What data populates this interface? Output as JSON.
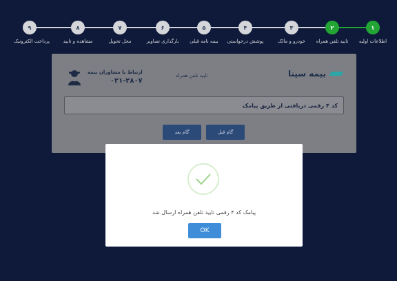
{
  "stepper": {
    "steps": [
      {
        "number": "۱",
        "label": "اطلاعات اولیه",
        "status": "done"
      },
      {
        "number": "۲",
        "label": "تایید تلفن همراه",
        "status": "done"
      },
      {
        "number": "۳",
        "label": "خودرو و مالک",
        "status": "pending"
      },
      {
        "number": "۴",
        "label": "پوشش درخواستی",
        "status": "pending"
      },
      {
        "number": "۵",
        "label": "بیمه نامه قبلی",
        "status": "pending"
      },
      {
        "number": "۶",
        "label": "بارگذاری تصاویر",
        "status": "pending"
      },
      {
        "number": "۷",
        "label": "محل تحویل",
        "status": "pending"
      },
      {
        "number": "۸",
        "label": "مشاهده و تایید",
        "status": "pending"
      },
      {
        "number": "۹",
        "label": "پرداخت الکترونیک",
        "status": "pending"
      }
    ],
    "colors": {
      "done": "#22a534",
      "pending": "#d4d6da"
    }
  },
  "card": {
    "brand": "بیمه سینا",
    "title": "تایید تلفن همراه",
    "consult_label": "ارتباط با مشاوران بیمه",
    "consult_phone": "۰۲۱-۲۸۰۷",
    "code_label": "کد ۴ رقمی دریافتی از طریق پیامک",
    "prev_button": "گام قبل",
    "next_button": "گام بعد"
  },
  "modal": {
    "message": "پیامک کد ۴ رقمی تایید تلفن همراه ارسال شد",
    "ok_button": "OK",
    "icon": "success-check-icon"
  }
}
